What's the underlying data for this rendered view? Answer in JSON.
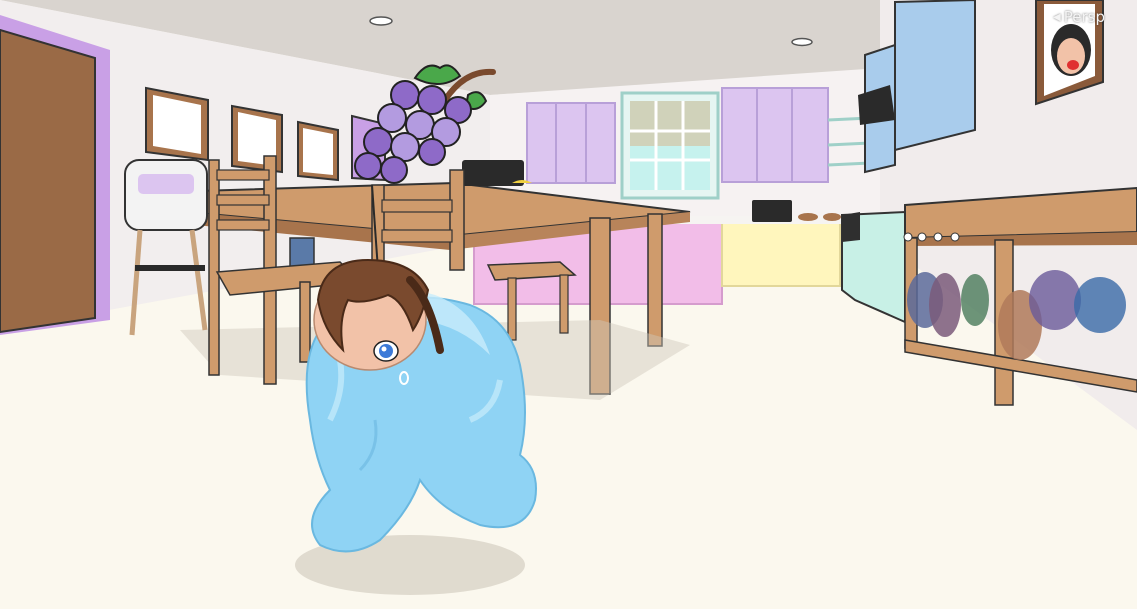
{
  "viewport": {
    "projection_label": "Persp"
  },
  "colors": {
    "wall": "#f2eeee",
    "floor": "#fbf8ee",
    "ceiling": "#d9d4cf",
    "door": "#9a6a46",
    "door_trim": "#c9a0e6",
    "wood": "#cf9b6c",
    "wood_dark": "#a8744c",
    "upper_cabinet": "#dcc5f0",
    "blue_cabinet": "#a9ccec",
    "pink_counter": "#f2bde8",
    "yellow_counter": "#fff6bd",
    "mint_fridge": "#c8f0e6",
    "window_sky": "#c6f2ee",
    "grape": "#8e6ac8",
    "grape_light": "#b39be0",
    "leaf": "#4aa84a",
    "suit": "#8fd3f4",
    "suit_light": "#c8ecfb",
    "hair": "#7a4a2e",
    "skin": "#f2c2a8",
    "eye": "#3c7ad8"
  },
  "icons": {
    "projection_arrow": "triangle-left-icon",
    "fruit": "grape-bunch-icon"
  }
}
